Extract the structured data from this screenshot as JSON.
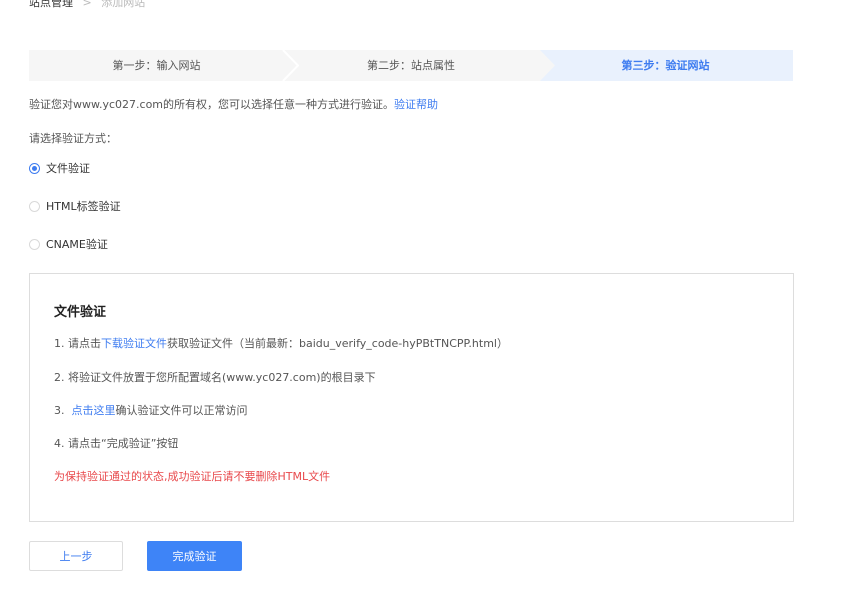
{
  "breadcrumb": {
    "parent": "站点管理",
    "separator": ">",
    "current": "添加网站"
  },
  "steps": [
    {
      "label": "第一步：输入网站",
      "active": false
    },
    {
      "label": "第二步：站点属性",
      "active": false
    },
    {
      "label": "第三步：验证网站",
      "active": true
    }
  ],
  "intro": {
    "text": "验证您对www.yc027.com的所有权，您可以选择任意一种方式进行验证。",
    "help_link": "验证帮助"
  },
  "choose_label": "请选择验证方式：",
  "methods": [
    {
      "label": "文件验证",
      "checked": true
    },
    {
      "label": "HTML标签验证",
      "checked": false
    },
    {
      "label": "CNAME验证",
      "checked": false
    }
  ],
  "panel": {
    "title": "文件验证",
    "step1": {
      "prefix": "1.  请点击",
      "link": "下载验证文件",
      "suffix": "获取验证文件（当前最新：baidu_verify_code-hyPBtTNCPP.html）"
    },
    "step2": "2.  将验证文件放置于您所配置域名(www.yc027.com)的根目录下",
    "step3": {
      "prefix": "3.  ",
      "link": "点击这里",
      "suffix": "确认验证文件可以正常访问"
    },
    "step4": "4.  请点击“完成验证”按钮",
    "warning": "为保持验证通过的状态,成功验证后请不要删除HTML文件"
  },
  "buttons": {
    "prev": "上一步",
    "finish": "完成验证"
  },
  "colors": {
    "accent": "#3e7cf0",
    "primary_button": "#3e84f7",
    "warning": "#e8484b",
    "active_step_bg": "#e9f1fd"
  }
}
